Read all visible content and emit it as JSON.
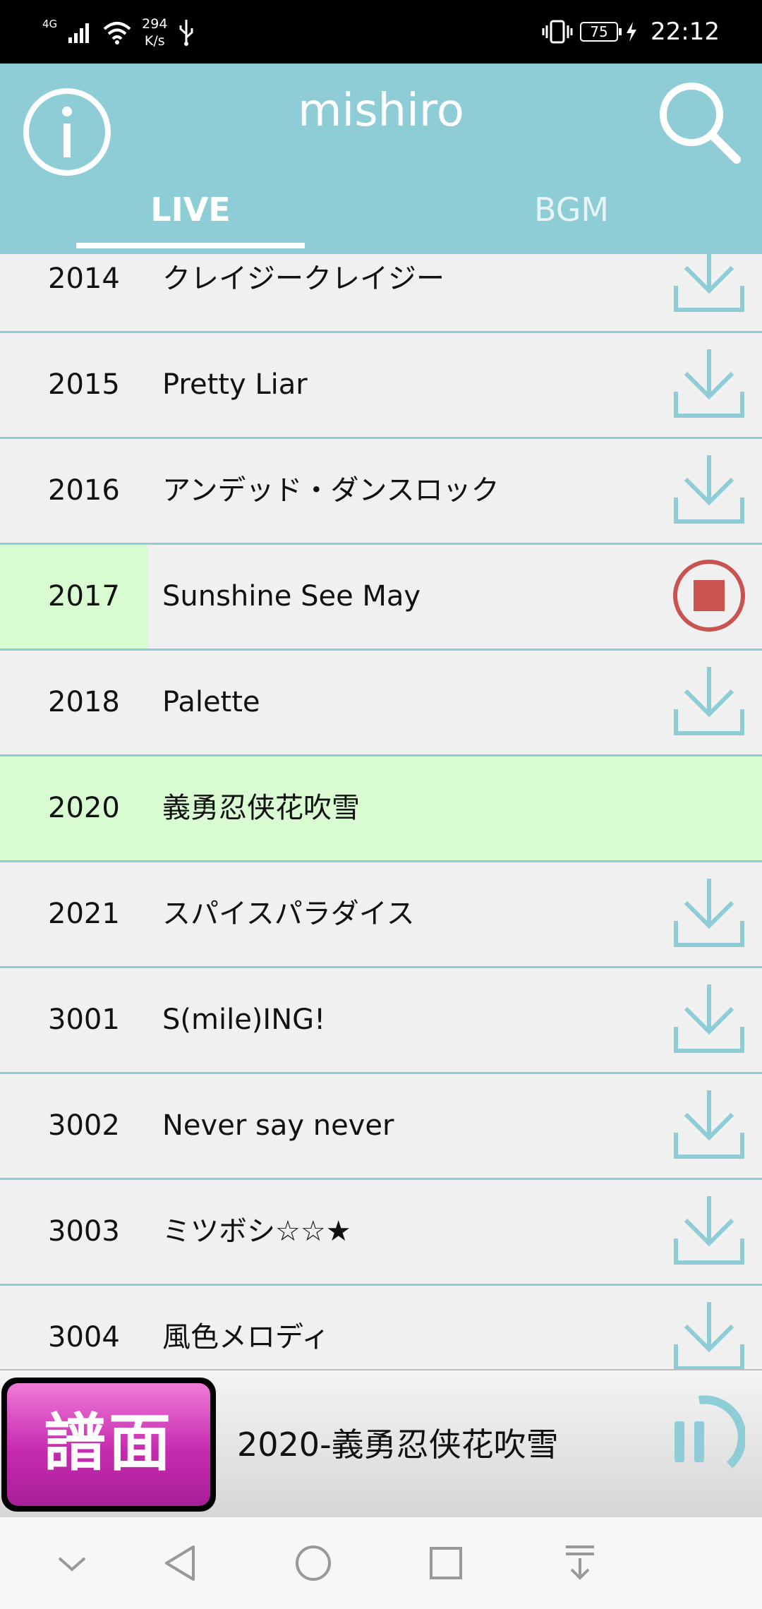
{
  "status": {
    "network": "4G",
    "speed_value": "294",
    "speed_unit": "K/s",
    "battery": "75",
    "time": "22:12"
  },
  "header": {
    "title": "mishiro",
    "tabs": [
      {
        "label": "LIVE",
        "active": true
      },
      {
        "label": "BGM",
        "active": false
      }
    ]
  },
  "songs": [
    {
      "id": "2014",
      "name": "クレイジークレイジー",
      "state": "download"
    },
    {
      "id": "2015",
      "name": "Pretty Liar",
      "state": "download"
    },
    {
      "id": "2016",
      "name": "アンデッド・ダンスロック",
      "state": "download"
    },
    {
      "id": "2017",
      "name": "Sunshine See May",
      "state": "stop"
    },
    {
      "id": "2018",
      "name": "Palette",
      "state": "download"
    },
    {
      "id": "2020",
      "name": "義勇忍侠花吹雪",
      "state": "selected"
    },
    {
      "id": "2021",
      "name": "スパイスパラダイス",
      "state": "download"
    },
    {
      "id": "3001",
      "name": "S(mile)ING!",
      "state": "download"
    },
    {
      "id": "3002",
      "name": "Never say never",
      "state": "download"
    },
    {
      "id": "3003",
      "name": "ミツボシ☆☆★",
      "state": "download"
    },
    {
      "id": "3004",
      "name": "風色メロディ",
      "state": "download"
    }
  ],
  "player": {
    "score_button": "譜面",
    "now_playing": "2020-義勇忍侠花吹雪",
    "state_icon": "pause-icon"
  },
  "colors": {
    "accent": "#8ecdd6",
    "highlight": "#d9fbd2",
    "stop": "#c9534f",
    "score_button": "#c62bb0"
  }
}
